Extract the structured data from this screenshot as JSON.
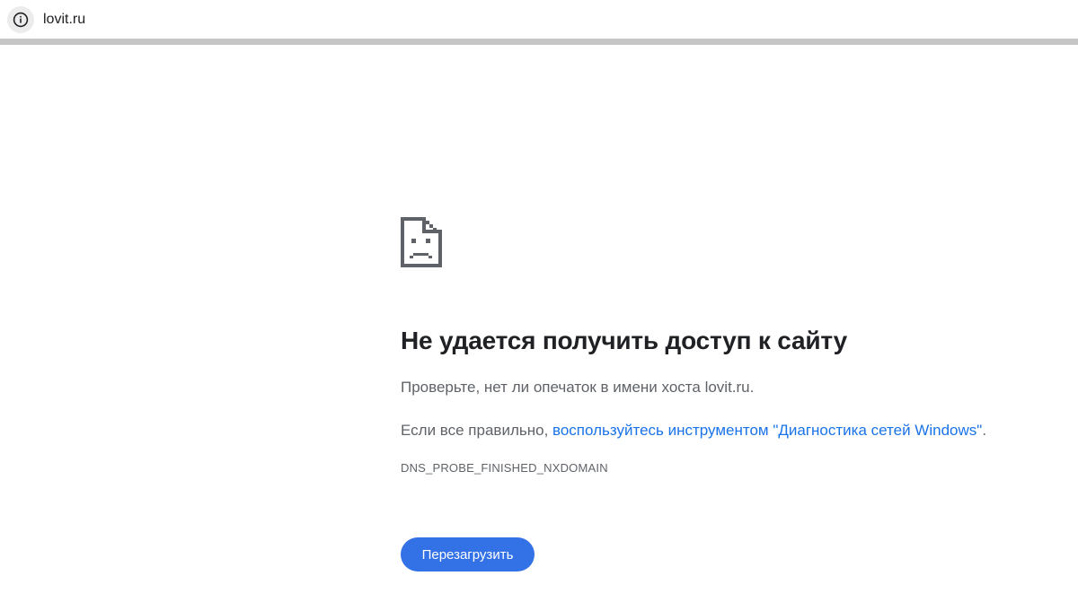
{
  "browser": {
    "url": "lovit.ru",
    "site_info_icon": "info-icon"
  },
  "error": {
    "icon": "sad-page-icon",
    "title": "Не удается получить доступ к сайту",
    "hint": "Проверьте, нет ли опечаток в имени хоста lovit.ru.",
    "diag_prefix": "Если все правильно, ",
    "diag_link": "воспользуйтесь инструментом \"Диагностика сетей Windows\"",
    "diag_suffix": ".",
    "code": "DNS_PROBE_FINISHED_NXDOMAIN",
    "reload_label": "Перезагрузить"
  },
  "colors": {
    "link": "#1a73e8",
    "button": "#3271e6",
    "text_primary": "#202124",
    "text_secondary": "#5f6368"
  }
}
